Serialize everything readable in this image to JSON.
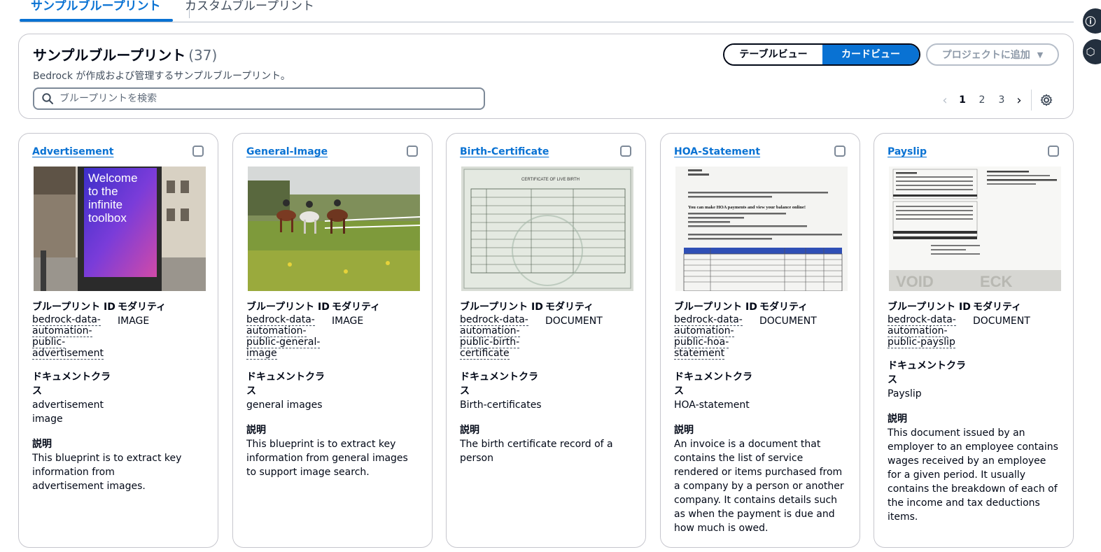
{
  "tabs": [
    {
      "label": "サンプルブループリント",
      "active": true
    },
    {
      "label": "カスタムブループリント",
      "active": false
    }
  ],
  "header": {
    "title": "サンプルブループリント",
    "count": "(37)",
    "description": "Bedrock が作成および管理するサンプルブループリント。",
    "search_placeholder": "ブループリントを検索",
    "view_table": "テーブルビュー",
    "view_card": "カードビュー",
    "add_to_project": "プロジェクトに追加",
    "pages": [
      "1",
      "2",
      "3"
    ],
    "current_page": "1"
  },
  "labels": {
    "blueprint_id": "ブループリント ID",
    "modality": "モダリティ",
    "doc_class": "ドキュメントクラス",
    "description": "説明"
  },
  "cards": [
    {
      "title": "Advertisement",
      "blueprint_id": "bedrock-data-automation-public-advertisement",
      "modality": "IMAGE",
      "doc_class": "advertisement image",
      "description": "This blueprint is to extract key information from advertisement images.",
      "image_text": "Welcome to the infinite toolbox"
    },
    {
      "title": "General-Image",
      "blueprint_id": "bedrock-data-automation-public-general-image",
      "modality": "IMAGE",
      "doc_class": "general images",
      "description": "This blueprint is to extract key information from general images to support image search."
    },
    {
      "title": "Birth-Certificate",
      "blueprint_id": "bedrock-data-automation-public-birth-certificate",
      "modality": "DOCUMENT",
      "doc_class": "Birth-certificates",
      "description": "The birth certificate record of a person",
      "image_text": "CERTIFICATE OF LIVE BIRTH"
    },
    {
      "title": "HOA-Statement",
      "blueprint_id": "bedrock-data-automation-public-hoa-statement",
      "modality": "DOCUMENT",
      "doc_class": "HOA-statement",
      "description": "An invoice is a document that contains the list of service rendered or items purchased from a company by a person or another company. It contains details such as when the payment is due and how much is owed.",
      "image_text": "You can make HOA payments and view your balance online!"
    },
    {
      "title": "Payslip",
      "blueprint_id": "bedrock-data-automation-public-payslip",
      "modality": "DOCUMENT",
      "doc_class": "Payslip",
      "description": "This document issued by an employer to an employee contains wages received by an employee for a given period. It usually contains the breakdown of each of the income and tax deductions items."
    }
  ],
  "colors": {
    "accent": "#0972d3",
    "text": "#000716",
    "border": "#c6c6cd"
  }
}
